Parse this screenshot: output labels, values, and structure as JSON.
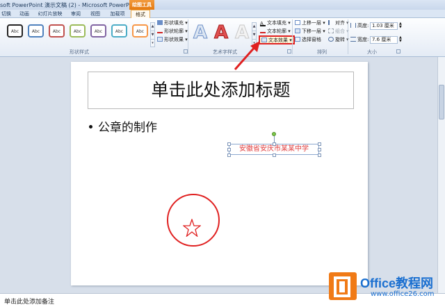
{
  "titlebar": {
    "title": "soft PowerPoint 演示文稿 (2) - Microsoft PowerPoint",
    "context_tab": "绘图工具"
  },
  "tabs": [
    {
      "label": "切换"
    },
    {
      "label": "动画"
    },
    {
      "label": "幻灯片放映"
    },
    {
      "label": "审阅"
    },
    {
      "label": "视图"
    },
    {
      "label": "加载项"
    },
    {
      "label": "格式"
    }
  ],
  "ribbon": {
    "shape_styles": {
      "label": "形状样式",
      "swatch_text": "Abc",
      "swatches": [
        {
          "border": "#222222"
        },
        {
          "border": "#4f81bd"
        },
        {
          "border": "#c0504d"
        },
        {
          "border": "#9bbb59"
        },
        {
          "border": "#8064a2"
        },
        {
          "border": "#4bacc6"
        },
        {
          "border": "#f79646"
        }
      ],
      "fill_label": "形状填充",
      "outline_label": "形状轮廓",
      "effects_label": "形状效果"
    },
    "wordart": {
      "label": "艺术字样式",
      "glyph": "A",
      "text_fill_label": "文本填充",
      "text_outline_label": "文本轮廓",
      "text_effects_label": "文本效果"
    },
    "arrange": {
      "label": "排列",
      "bring_forward": "上移一层",
      "send_backward": "下移一层",
      "selection_pane": "选择窗格",
      "align": "对齐",
      "group": "组合",
      "rotate": "旋转"
    },
    "size": {
      "label": "大小",
      "height_label": "高度:",
      "height_value": "1.03 厘米",
      "width_label": "宽度:",
      "width_value": "7.6 厘米"
    }
  },
  "slide": {
    "title_placeholder": "单击此处添加标题",
    "bullet": "公章的制作",
    "wordart_text": "安徽省安庆市某某中学"
  },
  "notes": {
    "placeholder": "单击此处添加备注"
  },
  "watermark": {
    "brand": "Office教程网",
    "url": "www.office26.com"
  },
  "colors": {
    "accent_red": "#e02020",
    "context_orange": "#e57a10"
  }
}
